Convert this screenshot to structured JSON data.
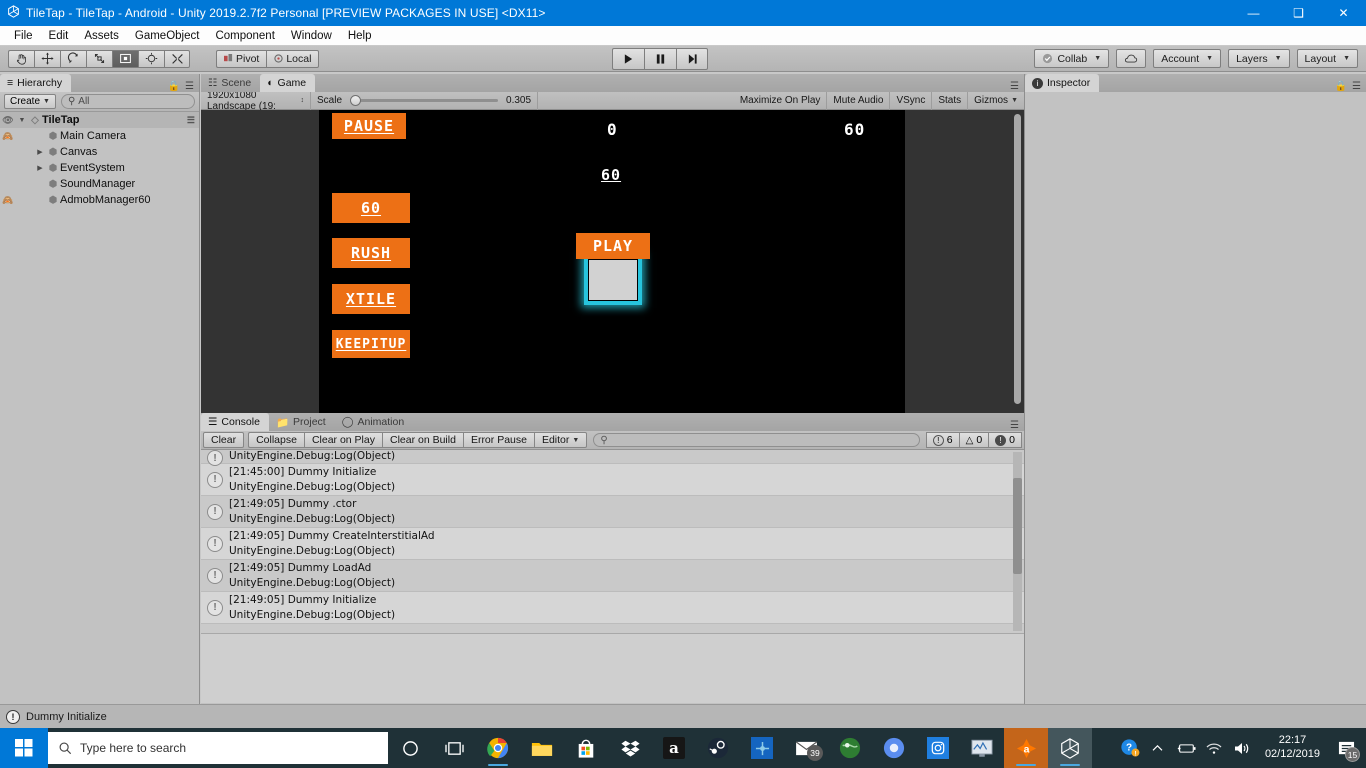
{
  "window": {
    "title": "TileTap - TileTap - Android - Unity 2019.2.7f2 Personal [PREVIEW PACKAGES IN USE] <DX11>",
    "app_icon": "unity-icon",
    "minimize": "—",
    "maximize": "❑",
    "close": "✕"
  },
  "menubar": {
    "items": [
      "File",
      "Edit",
      "Assets",
      "GameObject",
      "Component",
      "Window",
      "Help"
    ]
  },
  "toolbar": {
    "tools": [
      {
        "name": "hand-tool",
        "icon": "hand"
      },
      {
        "name": "move-tool",
        "icon": "move"
      },
      {
        "name": "rotate-tool",
        "icon": "rotate"
      },
      {
        "name": "scale-tool",
        "icon": "scale"
      },
      {
        "name": "rect-tool",
        "icon": "rect"
      },
      {
        "name": "transform-tool",
        "icon": "transform"
      },
      {
        "name": "custom-tool",
        "icon": "wrench"
      }
    ],
    "active_tool_index": 4,
    "pivot_label": "Pivot",
    "local_label": "Local",
    "play_label": "▶",
    "pause_label": "‖",
    "step_label": "▶|",
    "collab_label": "Collab",
    "cloud_label": "cloud-icon",
    "account_label": "Account",
    "layers_label": "Layers",
    "layout_label": "Layout"
  },
  "hierarchy": {
    "tab_label": "Hierarchy",
    "create_label": "Create",
    "search_placeholder": "All",
    "scene_name": "TileTap",
    "items": [
      {
        "label": "Main Camera",
        "indent": 1,
        "expandable": false,
        "hidden": true
      },
      {
        "label": "Canvas",
        "indent": 1,
        "expandable": true,
        "hidden": false
      },
      {
        "label": "EventSystem",
        "indent": 1,
        "expandable": true,
        "hidden": false
      },
      {
        "label": "SoundManager",
        "indent": 1,
        "expandable": false,
        "hidden": false
      },
      {
        "label": "AdmobManager60",
        "indent": 1,
        "expandable": false,
        "hidden": true
      }
    ]
  },
  "game_panel": {
    "tabs": [
      {
        "label": "Scene",
        "active": false,
        "icon": "grid-icon"
      },
      {
        "label": "Game",
        "active": true,
        "icon": "gamepad-icon"
      }
    ],
    "resolution": "1920x1080 Landscape (19:",
    "scale_label": "Scale",
    "scale_value": "0.305",
    "maximize_on_play": "Maximize On Play",
    "mute_audio": "Mute Audio",
    "vsync": "VSync",
    "stats": "Stats",
    "gizmos": "Gizmos",
    "content": {
      "pause_button": "PAUSE",
      "timer_button": "60",
      "rush_button": "RUSH",
      "xtile_button": "XTILE",
      "keepitup_button": "KEEPITUP",
      "play_button": "PLAY",
      "score_left": "0",
      "score_right": "60",
      "center_value": "60",
      "accent_orange": "#ed7015",
      "glow_cyan": "#27c4dd",
      "tile_gray": "#d2d2d2",
      "background": "#000000"
    }
  },
  "console": {
    "tabs": [
      {
        "label": "Console",
        "active": true,
        "icon": "console-icon"
      },
      {
        "label": "Project",
        "active": false,
        "icon": "folder-icon"
      },
      {
        "label": "Animation",
        "active": false,
        "icon": "clock-icon"
      }
    ],
    "buttons": [
      "Clear",
      "Collapse",
      "Clear on Play",
      "Clear on Build",
      "Error Pause",
      "Editor"
    ],
    "search_placeholder": "",
    "counts": {
      "info": "6",
      "warning": "0",
      "error": "0"
    },
    "entries": [
      {
        "message": "",
        "stack": "UnityEngine.Debug:Log(Object)",
        "clipped": true
      },
      {
        "message": "[21:45:00] Dummy Initialize",
        "stack": "UnityEngine.Debug:Log(Object)"
      },
      {
        "message": "[21:49:05] Dummy .ctor",
        "stack": "UnityEngine.Debug:Log(Object)"
      },
      {
        "message": "[21:49:05] Dummy CreateInterstitialAd",
        "stack": "UnityEngine.Debug:Log(Object)"
      },
      {
        "message": "[21:49:05] Dummy LoadAd",
        "stack": "UnityEngine.Debug:Log(Object)"
      },
      {
        "message": "[21:49:05] Dummy Initialize",
        "stack": "UnityEngine.Debug:Log(Object)"
      }
    ]
  },
  "inspector": {
    "tab_label": "Inspector"
  },
  "statusbar": {
    "message": "Dummy Initialize"
  },
  "taskbar": {
    "search_placeholder": "Type here to search",
    "apps": [
      {
        "name": "cortana-icon",
        "glyph": "○"
      },
      {
        "name": "task-view-icon",
        "glyph": "⌸"
      },
      {
        "name": "chrome-icon",
        "glyph": ""
      },
      {
        "name": "file-explorer-icon",
        "glyph": ""
      },
      {
        "name": "microsoft-store-icon",
        "glyph": ""
      },
      {
        "name": "dropbox-icon",
        "glyph": ""
      },
      {
        "name": "amazon-icon",
        "glyph": "a"
      },
      {
        "name": "steam-icon",
        "glyph": ""
      },
      {
        "name": "blue-app-icon",
        "glyph": ""
      },
      {
        "name": "mail-icon",
        "glyph": "",
        "badge": "39"
      },
      {
        "name": "globe-app-icon",
        "glyph": ""
      },
      {
        "name": "chromium-icon",
        "glyph": ""
      },
      {
        "name": "instagram-icon",
        "glyph": ""
      },
      {
        "name": "monitor-app-icon",
        "glyph": ""
      },
      {
        "name": "avast-icon",
        "glyph": "a"
      },
      {
        "name": "unity-taskbar-icon",
        "glyph": ""
      }
    ],
    "tray": {
      "help_icon": "?",
      "chevron": "∧",
      "battery": "▭",
      "wifi": "◠",
      "volume": "ὐA",
      "time": "22:17",
      "date": "02/12/2019",
      "notification_badge": "15"
    }
  }
}
